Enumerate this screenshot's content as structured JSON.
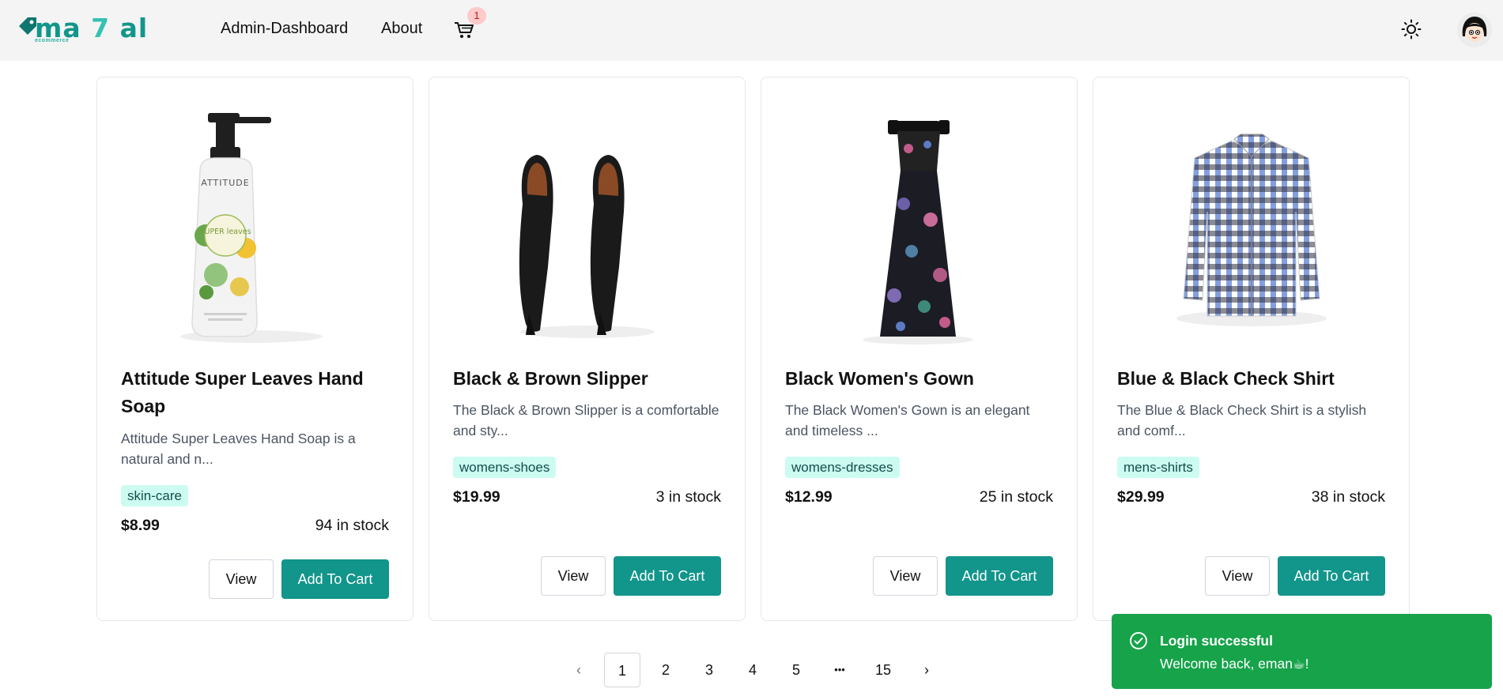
{
  "header": {
    "logo": {
      "text_a": "ma ",
      "text_b": "7",
      "text_c": " al",
      "sub": "ecommerce"
    },
    "nav": {
      "admin": "Admin-Dashboard",
      "about": "About"
    },
    "cart_count": "1",
    "icons": {
      "cart": "shopping-cart-icon",
      "theme": "sun-icon",
      "avatar": "user-avatar"
    }
  },
  "products": [
    {
      "title": "Attitude Super Leaves Hand Soap",
      "description": "Attitude Super Leaves Hand Soap is a natural and n...",
      "category": "skin-care",
      "price": "$8.99",
      "stock": "94 in stock",
      "view_label": "View",
      "cart_label": "Add To Cart",
      "image": "hand-soap-bottle",
      "image_brand": "ATTITUDE",
      "image_name": "SUPER leaves"
    },
    {
      "title": "Black & Brown Slipper",
      "description": "The Black & Brown Slipper is a comfortable and sty...",
      "category": "womens-shoes",
      "price": "$19.99",
      "stock": "3 in stock",
      "view_label": "View",
      "cart_label": "Add To Cart",
      "image": "black-heels"
    },
    {
      "title": "Black Women's Gown",
      "description": "The Black Women's Gown is an elegant and timeless ...",
      "category": "womens-dresses",
      "price": "$12.99",
      "stock": "25 in stock",
      "view_label": "View",
      "cart_label": "Add To Cart",
      "image": "floral-gown"
    },
    {
      "title": "Blue & Black Check Shirt",
      "description": "The Blue & Black Check Shirt is a stylish and comf...",
      "category": "mens-shirts",
      "price": "$29.99",
      "stock": "38 in stock",
      "view_label": "View",
      "cart_label": "Add To Cart",
      "image": "check-shirt"
    }
  ],
  "pagination": {
    "prev": "‹",
    "pages": [
      "1",
      "2",
      "3",
      "4",
      "5"
    ],
    "ellipsis": "•••",
    "last": "15",
    "next": "›",
    "active": "1"
  },
  "toast": {
    "title": "Login successful",
    "message": "Welcome back, eman☕!",
    "icon": "check-circle-icon"
  },
  "colors": {
    "accent": "#12958a",
    "badge_bg": "#ccfbf1",
    "toast_bg": "#16a34a",
    "header_bg": "#f4f4f4"
  }
}
